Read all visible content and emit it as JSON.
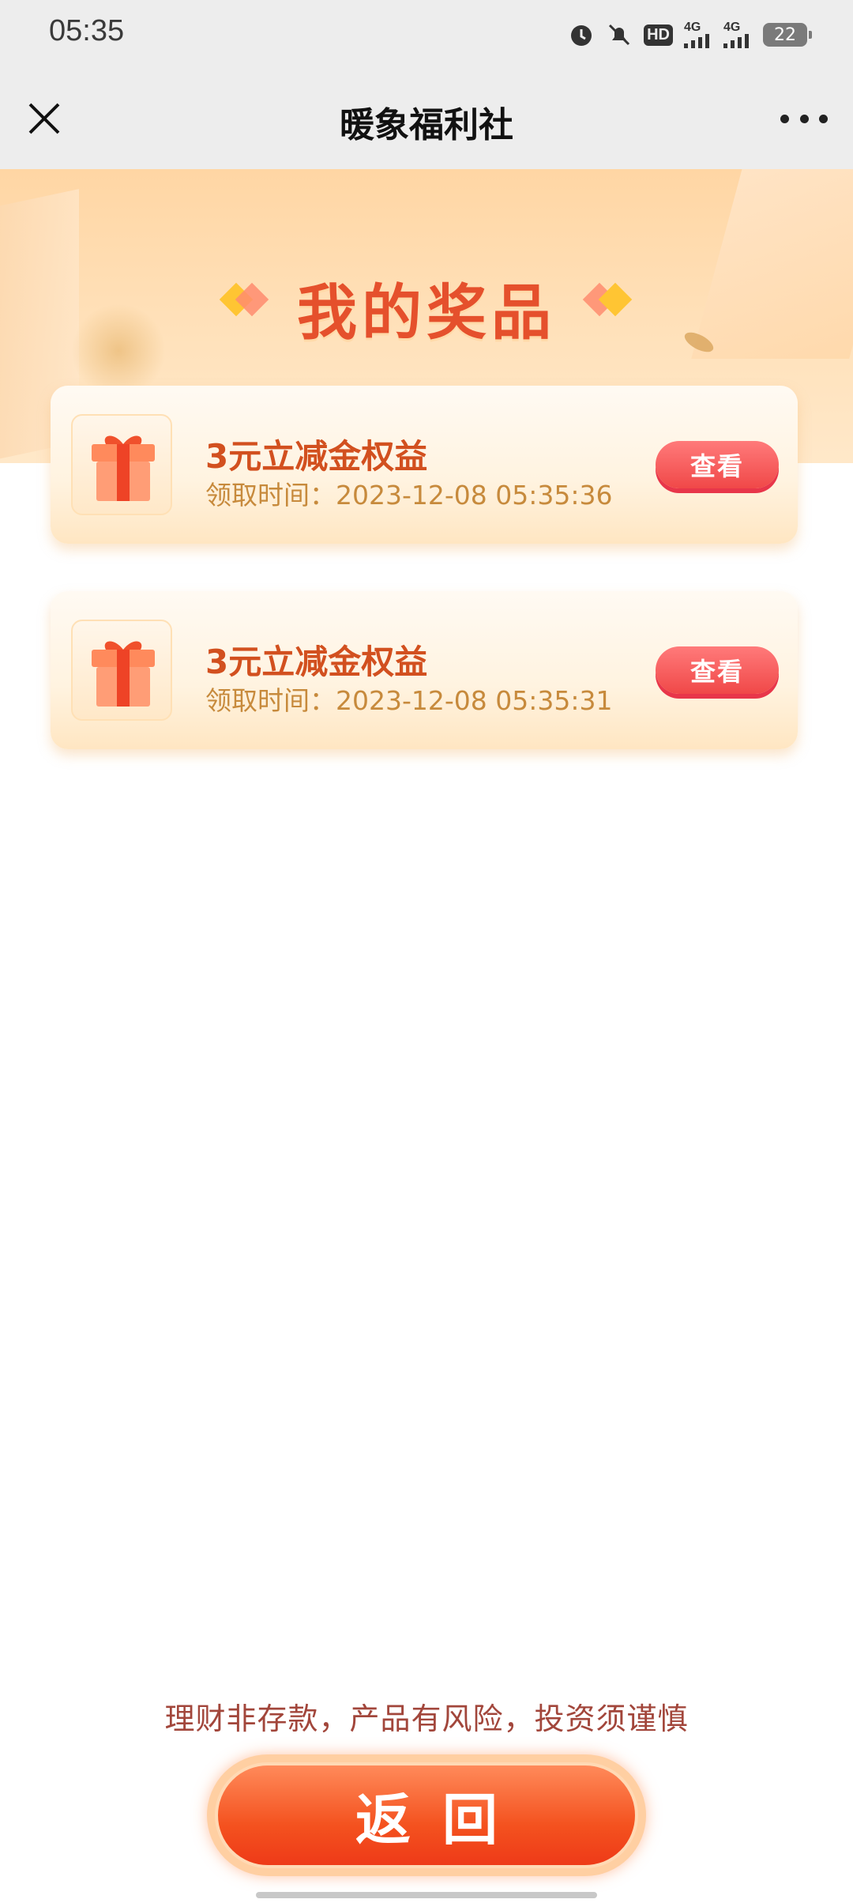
{
  "status_bar": {
    "time": "05:35",
    "icons": [
      "alarm-icon",
      "mute-icon",
      "hd-icon",
      "signal-4g-icon",
      "signal-4g-icon"
    ],
    "hd_label": "HD",
    "net1_label": "4G",
    "net2_label": "4G",
    "battery": "22"
  },
  "nav": {
    "title": "暖象福利社",
    "close_icon": "close-icon",
    "more_icon": "more-icon"
  },
  "hero": {
    "title": "我的奖品"
  },
  "prizes": [
    {
      "name": "3元立减金权益",
      "time": "领取时间：2023-12-08 05:35:36",
      "button": "查看"
    },
    {
      "name": "3元立减金权益",
      "time": "领取时间：2023-12-08 05:35:31",
      "button": "查看"
    }
  ],
  "footer": {
    "disclaimer": "理财非存款，产品有风险，投资须谨慎",
    "return_label": "返回"
  },
  "colors": {
    "accent": "#e5502c",
    "button_red": "#f04848",
    "return_orange": "#f4521f"
  }
}
